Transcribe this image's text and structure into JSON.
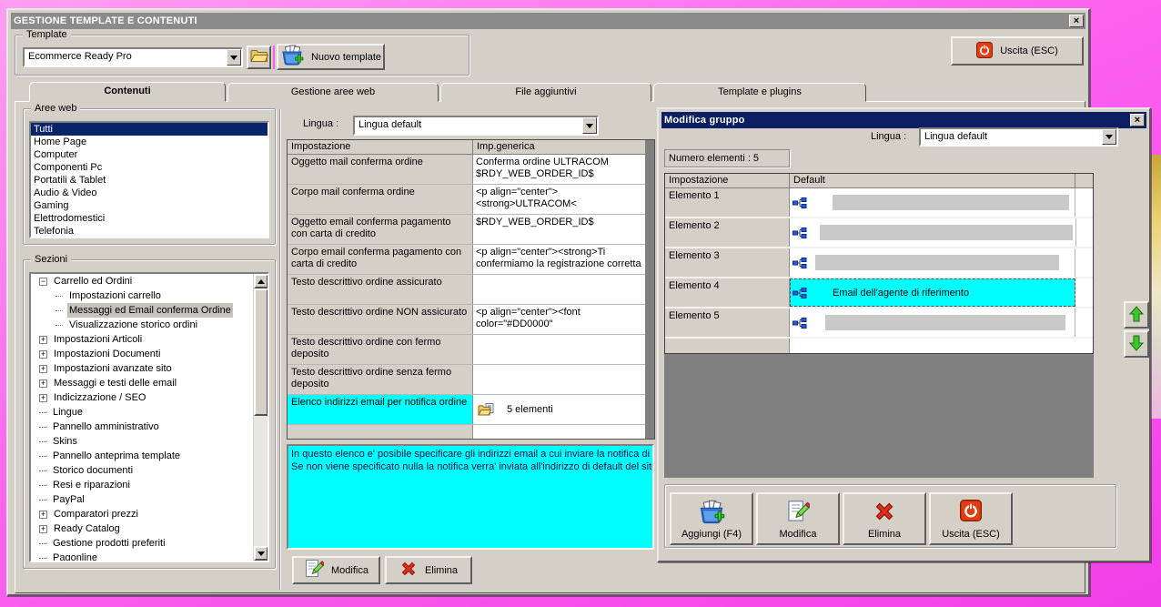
{
  "colors": {
    "desktop_pink": "#fb60f0",
    "window_face": "#d4d0c8",
    "caption_inactive": "#8b8b8b",
    "caption_active": "#0c1f63",
    "selection_blue": "#0a246a",
    "highlight_cyan": "#00ffff"
  },
  "main_window": {
    "title": "GESTIONE TEMPLATE E CONTENUTI",
    "template_box": {
      "label": "Template",
      "selected_template": "Ecommerce Ready Pro",
      "new_template_button": "Nuovo template"
    },
    "exit_button": "Uscita (ESC)",
    "tabs": [
      "Contenuti",
      "Gestione aree web",
      "File aggiuntivi",
      "Template e plugins"
    ],
    "active_tab": "Contenuti",
    "aree_web": {
      "label": "Aree web",
      "selected": "Tutti",
      "items": [
        "Tutti",
        "Home Page",
        "Computer",
        "Componenti Pc",
        "Portatili & Tablet",
        "Audio & Video",
        "Gaming",
        "Elettrodomestici",
        "Telefonia"
      ]
    },
    "sezioni": {
      "label": "Sezioni",
      "selected": "Messaggi ed Email conferma Ordine",
      "items": [
        {
          "label": "Carrello ed Ordini",
          "level": 0,
          "glyph": "minus"
        },
        {
          "label": "Impostazioni carrello",
          "level": 1,
          "glyph": "leaf"
        },
        {
          "label": "Messaggi ed Email conferma Ordine",
          "level": 1,
          "glyph": "leaf",
          "selected": true
        },
        {
          "label": "Visualizzazione storico ordini",
          "level": 1,
          "glyph": "leaf"
        },
        {
          "label": "Impostazioni Articoli",
          "level": 0,
          "glyph": "plus"
        },
        {
          "label": "Impostazioni Documenti",
          "level": 0,
          "glyph": "plus"
        },
        {
          "label": "Impostazioni avanzate sito",
          "level": 0,
          "glyph": "plus"
        },
        {
          "label": "Messaggi e testi delle email",
          "level": 0,
          "glyph": "plus"
        },
        {
          "label": "Indicizzazione / SEO",
          "level": 0,
          "glyph": "plus"
        },
        {
          "label": "Lingue",
          "level": 0,
          "glyph": "leaf"
        },
        {
          "label": "Pannello amministrativo",
          "level": 0,
          "glyph": "leaf"
        },
        {
          "label": "Skins",
          "level": 0,
          "glyph": "leaf"
        },
        {
          "label": "Pannello anteprima template",
          "level": 0,
          "glyph": "leaf"
        },
        {
          "label": "Storico documenti",
          "level": 0,
          "glyph": "leaf"
        },
        {
          "label": "Resi e riparazioni",
          "level": 0,
          "glyph": "leaf"
        },
        {
          "label": "PayPal",
          "level": 0,
          "glyph": "leaf"
        },
        {
          "label": "Comparatori prezzi",
          "level": 0,
          "glyph": "plus"
        },
        {
          "label": "Ready Catalog",
          "level": 0,
          "glyph": "plus"
        },
        {
          "label": "Gestione prodotti preferiti",
          "level": 0,
          "glyph": "leaf"
        },
        {
          "label": "Pagonline",
          "level": 0,
          "glyph": "leaf"
        }
      ]
    },
    "content_panel": {
      "lingua_label": "Lingua :",
      "lingua_value": "Lingua default",
      "table": {
        "headers": [
          "Impostazione",
          "Imp.generica"
        ],
        "rows": [
          {
            "name": "Oggetto mail conferma ordine",
            "value": "Conferma ordine ULTRACOM $RDY_WEB_ORDER_ID$"
          },
          {
            "name": "Corpo mail conferma ordine",
            "value": "<p align=\"center\"><strong>ULTRACOM<"
          },
          {
            "name": "Oggetto email conferma pagamento con carta di credito",
            "value": "$RDY_WEB_ORDER_ID$"
          },
          {
            "name": "Corpo email conferma pagamento con carta di credito",
            "value": "<p align=\"center\"><strong>Ti confermiamo la registrazione corretta"
          },
          {
            "name": "Testo descrittivo ordine assicurato",
            "value": ""
          },
          {
            "name": "Testo descrittivo ordine NON assicurato",
            "value": "<p align=\"center\"><font color=\"#DD0000\""
          },
          {
            "name": "Testo descrittivo ordine con fermo deposito",
            "value": ""
          },
          {
            "name": "Testo descrittivo ordine senza fermo deposito",
            "value": ""
          },
          {
            "name": "Elenco indirizzi email per notifica ordine",
            "value": "5 elementi",
            "selected": true,
            "icon": "folder-list-icon"
          }
        ]
      },
      "info_lines": [
        "In questo elenco e' posibile specificare gli indirizzi email a cui inviare la notifica di un",
        "Se non viene specificato nulla la notifica verra' inviata all'indirizzo di default del sito"
      ],
      "modify_button": "Modifica",
      "delete_button": "Elimina"
    }
  },
  "dialog": {
    "title": "Modifica gruppo",
    "lingua_label": "Lingua :",
    "lingua_value": "Lingua default",
    "numero_elementi": "Numero elementi : 5",
    "table": {
      "headers": [
        "Impostazione",
        "Default"
      ],
      "rows": [
        {
          "name": "Elemento 1",
          "value": ""
        },
        {
          "name": "Elemento 2",
          "value": ""
        },
        {
          "name": "Elemento 3",
          "value": ""
        },
        {
          "name": "Elemento 4",
          "value": "Email dell'agente di riferimento",
          "selected": true
        },
        {
          "name": "Elemento 5",
          "value": ""
        }
      ]
    },
    "buttons": {
      "add": "Aggiungi (F4)",
      "modify": "Modifica",
      "delete": "Elimina",
      "exit": "Uscita (ESC)"
    }
  }
}
